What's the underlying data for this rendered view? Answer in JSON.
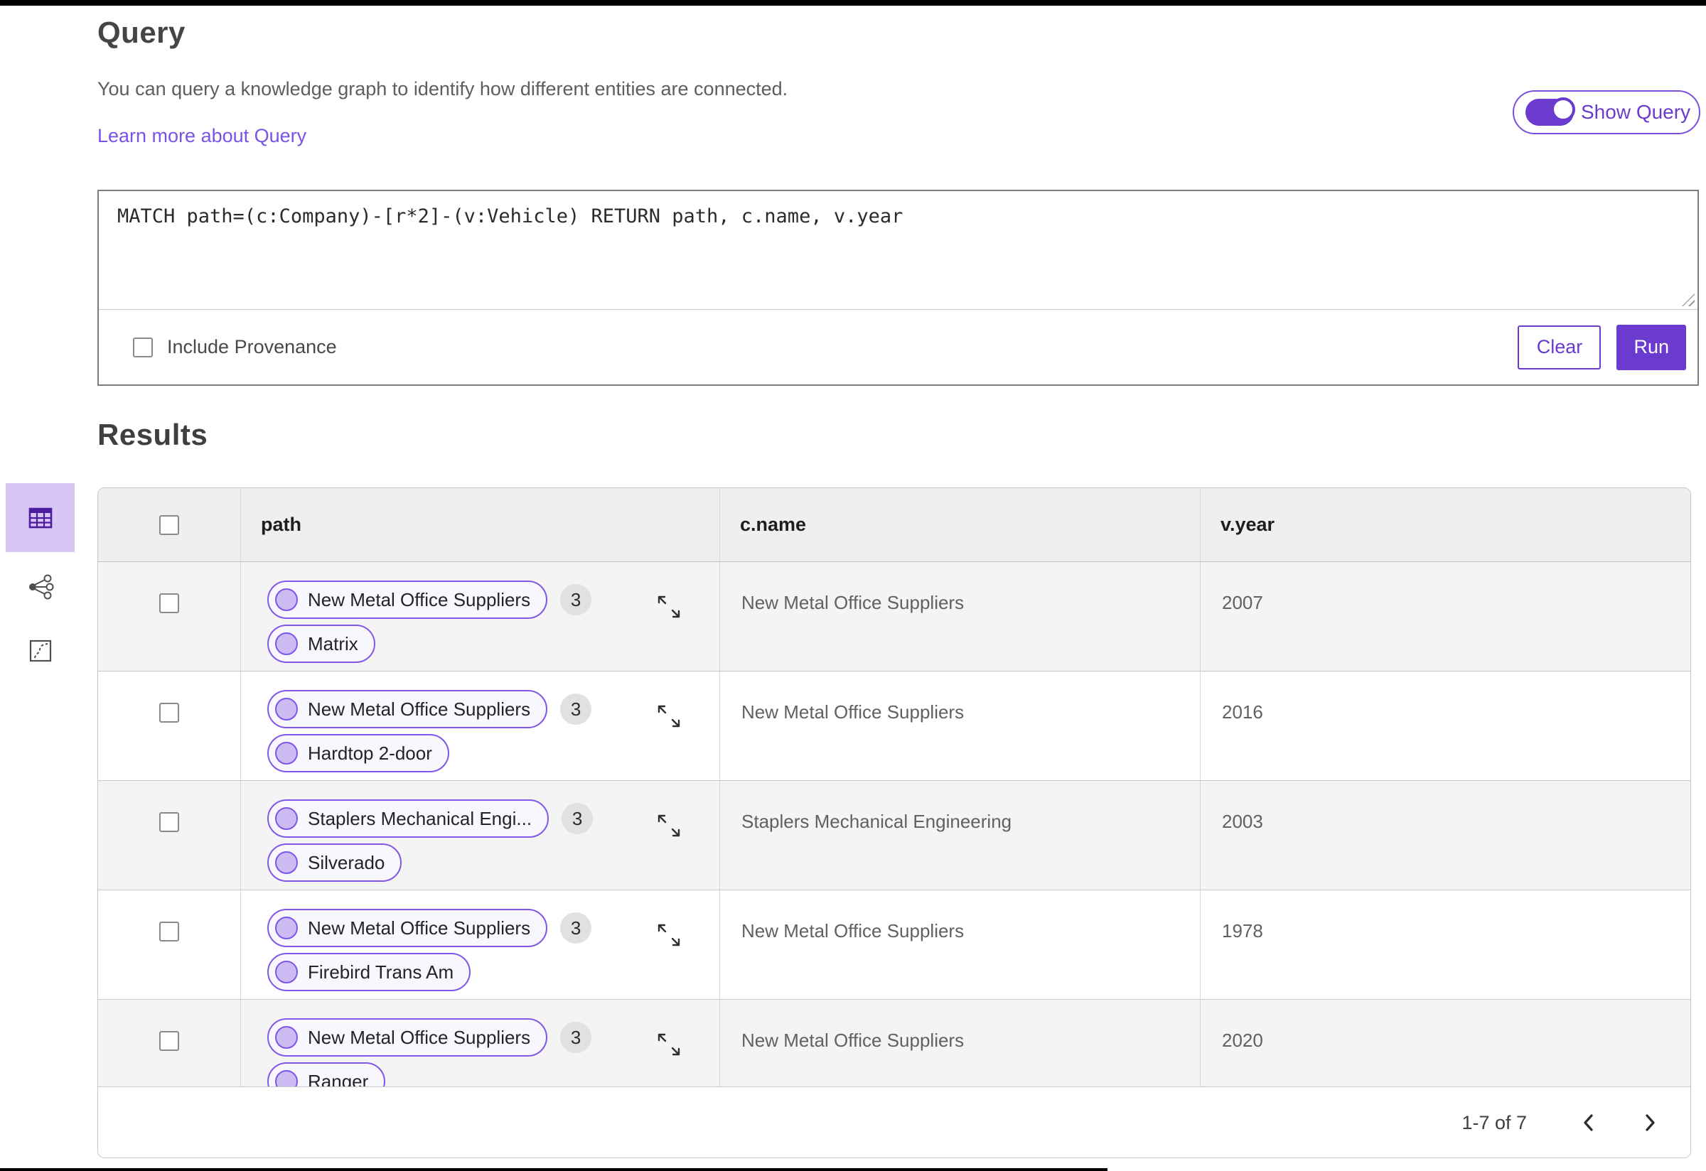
{
  "colors": {
    "accent_purple": "#6B3ACF",
    "link_purple": "#7A52E8",
    "selected_icon_purple": "#4C1D9E",
    "sidebar_selected_bg": "#D8C6F6",
    "pill_border": "#8257E5",
    "pill_bg": "#F9F7FE",
    "pill_circle_fill": "#CDBCF4",
    "badge_bg": "#E1E1E3",
    "header_row_bg": "#EFEFF0",
    "zebra_row_bg": "#F4F4F4"
  },
  "query_section": {
    "title": "Query",
    "description": "You can query a knowledge graph to identify how different entities are connected.",
    "learn_more_link": "Learn more about Query",
    "show_query_toggle": {
      "label": "Show Query",
      "state": "on"
    },
    "editor_text": "MATCH path=(c:Company)-[r*2]-(v:Vehicle) RETURN path, c.name, v.year",
    "include_provenance": {
      "label": "Include Provenance",
      "checked": false
    },
    "buttons": {
      "clear": "Clear",
      "run": "Run"
    }
  },
  "view_switcher": {
    "items": [
      {
        "name": "table-view",
        "selected": true
      },
      {
        "name": "graph-view",
        "selected": false
      },
      {
        "name": "map-view",
        "selected": false
      }
    ]
  },
  "results_section": {
    "title": "Results",
    "columns": [
      "path",
      "c.name",
      "v.year"
    ],
    "rows": [
      {
        "source": "New Metal Office Suppliers",
        "target": "Matrix",
        "count": "3",
        "c_name": "New Metal Office Suppliers",
        "v_year": "2007"
      },
      {
        "source": "New Metal Office Suppliers",
        "target": "Hardtop 2-door",
        "count": "3",
        "c_name": "New Metal Office Suppliers",
        "v_year": "2016"
      },
      {
        "source": "Staplers Mechanical Engi...",
        "target": "Silverado",
        "count": "3",
        "c_name": "Staplers Mechanical Engineering",
        "v_year": "2003"
      },
      {
        "source": "New Metal Office Suppliers",
        "target": "Firebird Trans Am",
        "count": "3",
        "c_name": "New Metal Office Suppliers",
        "v_year": "1978"
      },
      {
        "source": "New Metal Office Suppliers",
        "target": "Ranger",
        "count": "3",
        "c_name": "New Metal Office Suppliers",
        "v_year": "2020"
      }
    ],
    "pagination": {
      "range_label": "1-7 of 7"
    }
  }
}
